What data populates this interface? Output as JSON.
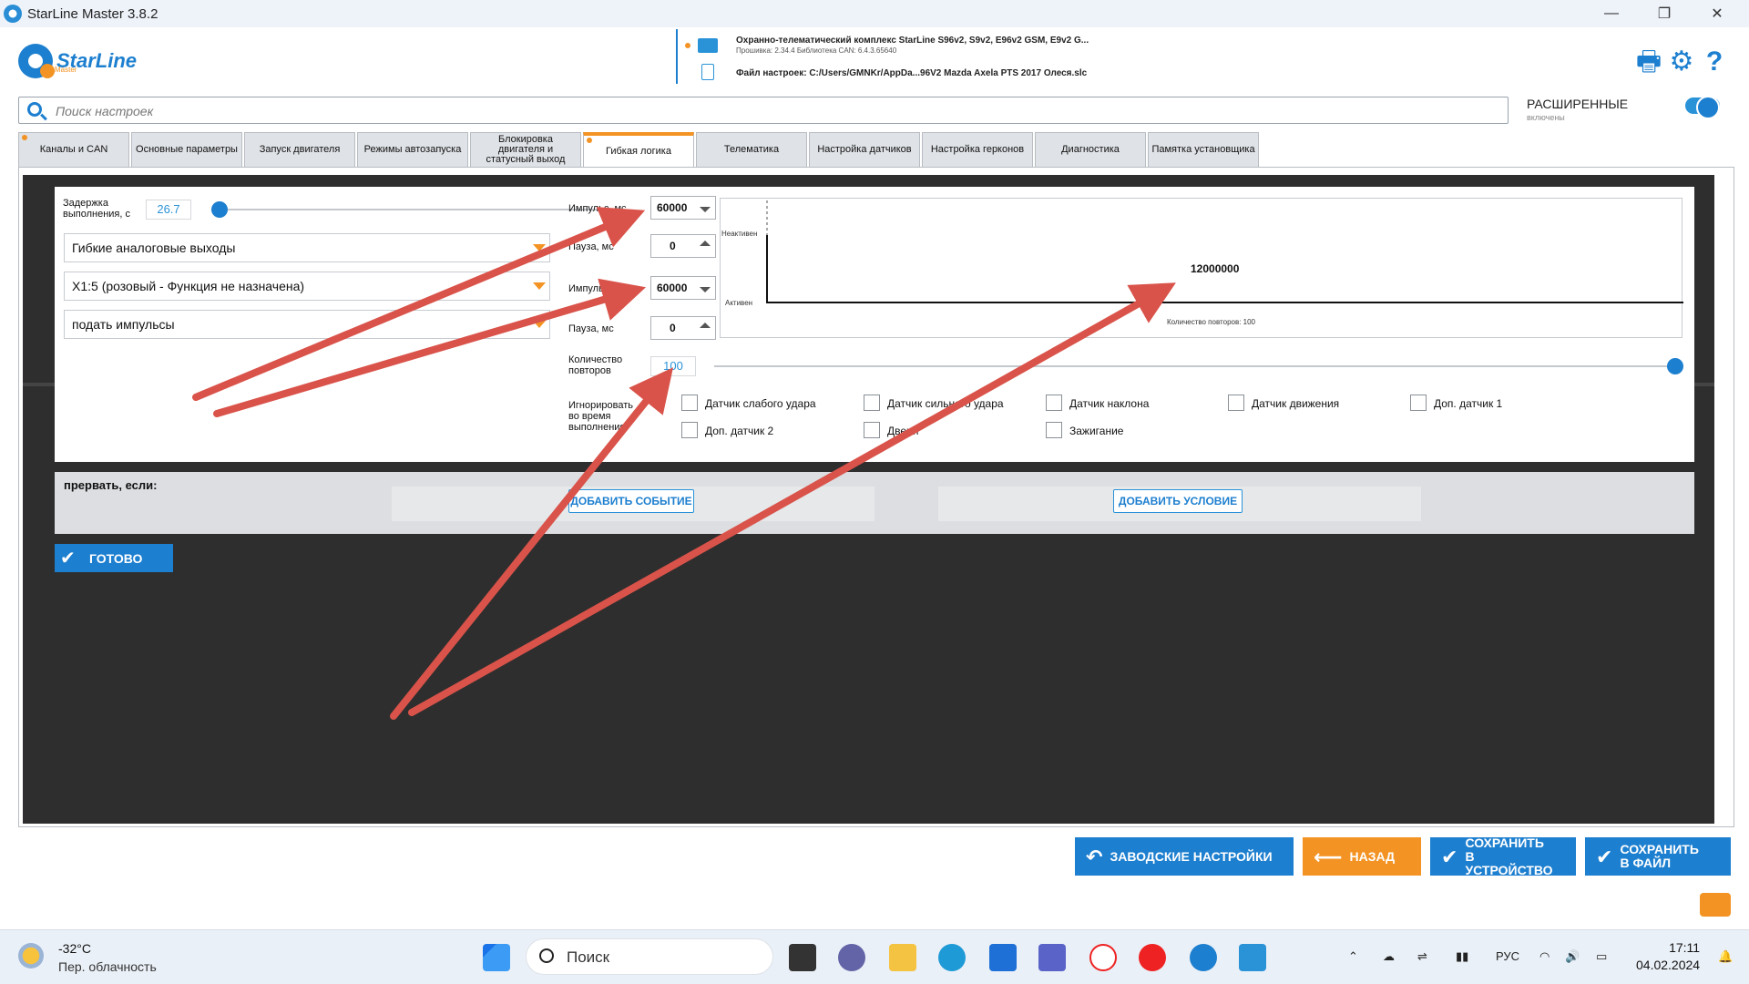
{
  "window": {
    "title": "StarLine Master 3.8.2"
  },
  "header": {
    "logo_text": "StarLine",
    "logo_sub": "Master",
    "device_name": "Охранно-телематический комплекс StarLine S96v2, S9v2, E96v2 GSM, E9v2 G...",
    "device_fw": "Прошивка: 2.34.4    Библиотека CAN: 6.4.3.65640",
    "settings_file": "Файл настроек: C:/Users/GMNKr/AppDa...96V2 Mazda Axela PTS 2017 Олеся.slc"
  },
  "search": {
    "placeholder": "Поиск настроек"
  },
  "advanced": {
    "title": "РАСШИРЕННЫЕ",
    "subtitle": "включены"
  },
  "tabs": [
    "Каналы и CAN",
    "Основные параметры",
    "Запуск двигателя",
    "Режимы автозапуска",
    "Блокировка двигателя и статусный выход",
    "Гибкая логика",
    "Телематика",
    "Настройка датчиков",
    "Настройка герконов",
    "Диагностика",
    "Памятка установщика"
  ],
  "dialog": {
    "delay_label": "Задержка выполнения, с",
    "delay_value": "26.7",
    "select1": "Гибкие аналоговые выходы",
    "select2": "X1:5 (розовый - Функция не назначена)",
    "select3": "подать импульсы",
    "impulse1_label": "Импульс, мс",
    "impulse1_value": "60000",
    "pause1_label": "Пауза, мс",
    "pause1_value": "0",
    "impulse2_label": "Импульс, мс",
    "impulse2_value": "60000",
    "pause2_label": "Пауза, мс",
    "pause2_value": "0",
    "graph_inactive": "Неактивен",
    "graph_active": "Активен",
    "graph_total": "12000000",
    "graph_repeats": "Количество повторов: 100",
    "repeats_label": "Количество повторов",
    "repeats_value": "100",
    "ignore_label": "Игнорировать во время выполнения",
    "checkboxes": [
      "Датчик слабого удара",
      "Датчик сильного удара",
      "Датчик наклона",
      "Датчик движения",
      "Доп. датчик 1",
      "Доп. датчик 2",
      "Двери",
      "Зажигание"
    ]
  },
  "break_panel": {
    "label": "прервать, если:",
    "add_event": "ДОБАВИТЬ СОБЫТИЕ",
    "add_condition": "ДОБАВИТЬ УСЛОВИЕ"
  },
  "ready_button": "ГОТОВО",
  "bottom_buttons": {
    "factory": "ЗАВОДСКИЕ НАСТРОЙКИ",
    "back": "НАЗАД",
    "save_device": "СОХРАНИТЬ В УСТРОЙСТВО",
    "save_file": "СОХРАНИТЬ В ФАЙЛ"
  },
  "taskbar": {
    "temp": "-32°C",
    "weather": "Пер. облачность",
    "search": "Поиск",
    "lang": "РУС",
    "time": "17:11",
    "date": "04.02.2024"
  },
  "colors": {
    "accent": "#1d7fcf",
    "orange": "#f39323",
    "arrow": "#d9534a"
  }
}
